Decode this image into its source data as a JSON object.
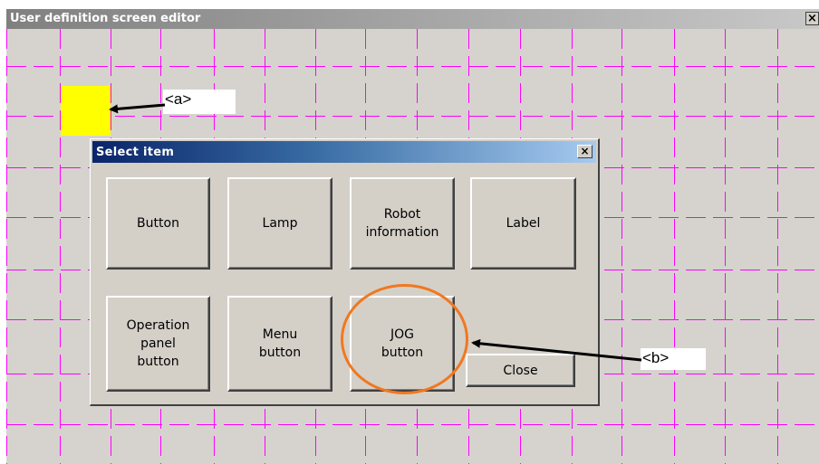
{
  "editor": {
    "title": "User definition screen editor",
    "close_glyph": "×",
    "grid_color": "#ff00ff",
    "background": "#d6d3ce",
    "selected_cell_color": "#ffff00"
  },
  "callouts": {
    "a": "<a>",
    "b": "<b>"
  },
  "dialog": {
    "title": "Select item",
    "close_glyph": "×",
    "buttons": {
      "button": "Button",
      "lamp": "Lamp",
      "robot_information": "Robot\ninformation",
      "label": "Label",
      "operation_panel_button": "Operation\npanel\nbutton",
      "menu_button": "Menu\nbutton",
      "jog_button": "JOG\nbutton",
      "close": "Close"
    }
  },
  "highlight_color": "#f07820"
}
